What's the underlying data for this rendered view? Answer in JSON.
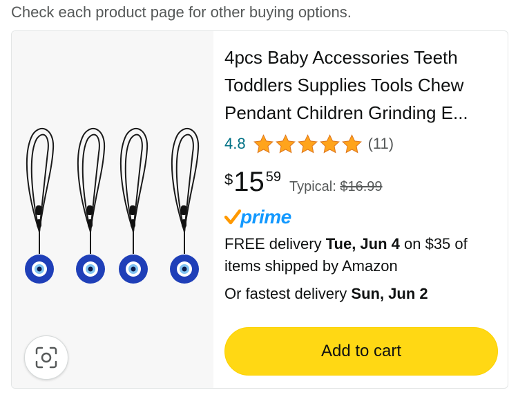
{
  "notice": "Check each product page for other buying options.",
  "product": {
    "title": "4pcs Baby Accessories Teeth Toddlers Supplies Tools Chew Pendant Children Grinding E...",
    "rating": "4.8",
    "rating_stars": 5,
    "review_count": "(11)",
    "price": {
      "symbol": "$",
      "whole": "15",
      "fraction": "59"
    },
    "typical_label": "Typical:",
    "typical_price": "$16.99",
    "prime_label": "prime",
    "delivery": {
      "prefix": "FREE delivery ",
      "date": "Tue, Jun 4",
      "suffix": " on $35 of items shipped by Amazon"
    },
    "fastest": {
      "prefix": "Or fastest delivery ",
      "date": "Sun, Jun 2"
    },
    "add_to_cart_label": "Add to cart",
    "image_icon": "visual-search-icon"
  },
  "colors": {
    "link": "#007185",
    "star": "#ffa41c",
    "prime": "#1399ff",
    "button": "#ffd814",
    "text": "#0f1111",
    "secondary": "#565959",
    "image_bg": "#f7f7f7",
    "pendant_blue": "#1f3fb8"
  }
}
